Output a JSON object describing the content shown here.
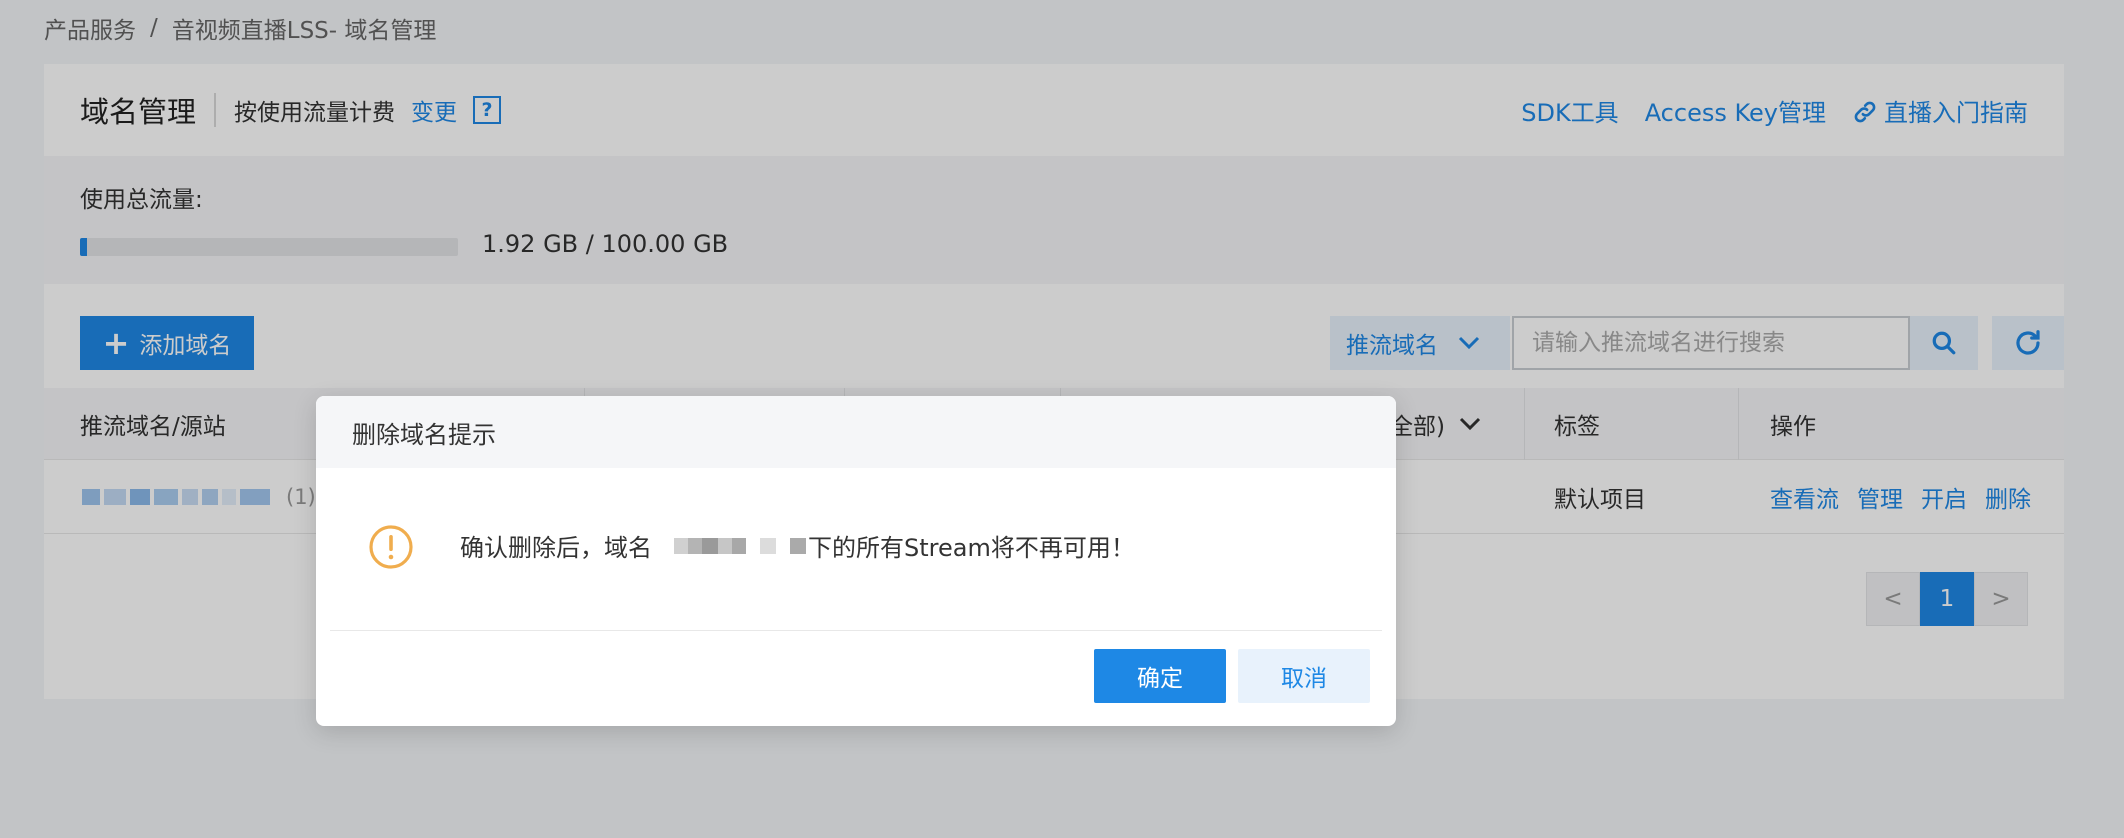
{
  "breadcrumb": {
    "items": [
      "产品服务",
      "音视频直播LSS- 域名管理"
    ],
    "separator": "/"
  },
  "header": {
    "title": "域名管理",
    "billing": "按使用流量计费",
    "change_link": "变更",
    "help": "?",
    "links": {
      "sdk": "SDK工具",
      "access_key": "Access Key管理",
      "guide": "直播入门指南"
    }
  },
  "usage": {
    "label": "使用总流量:",
    "used_fraction": 0.0192,
    "text": "1.92 GB / 100.00 GB"
  },
  "toolbar": {
    "add_label": "添加域名",
    "search_type": "推流域名",
    "search_placeholder": "请输入推流域名进行搜索"
  },
  "table": {
    "columns": [
      "推流域名/源站",
      "全部)",
      "标签",
      "操作"
    ],
    "rows": [
      {
        "count": "(1)",
        "tag": "默认项目",
        "actions": [
          "查看流",
          "管理",
          "开启",
          "删除"
        ]
      }
    ]
  },
  "pagination": {
    "prev": "<",
    "current": "1",
    "next": ">"
  },
  "modal": {
    "title": "删除域名提示",
    "message_before": "确认删除后，域名",
    "message_after": "下的所有Stream将不再可用！",
    "confirm": "确定",
    "cancel": "取消"
  },
  "colors": {
    "accent": "#1e88e5",
    "warning": "#f0ad4e"
  }
}
